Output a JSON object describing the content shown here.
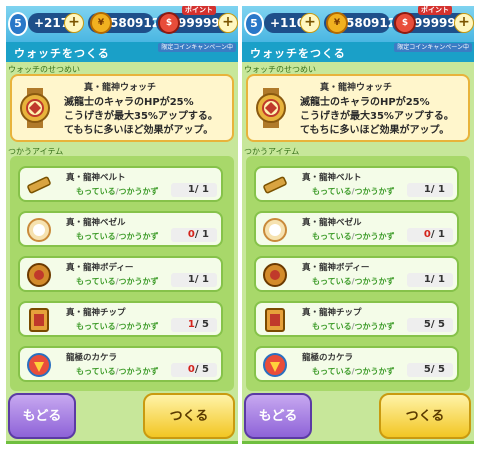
{
  "screens": [
    {
      "status": {
        "level": "5",
        "stat_value": "+217",
        "gold": "580912",
        "money": "9999999",
        "points_tag": "ポイント",
        "campaign_tag": "限定コインキャンペーン中"
      },
      "title": "ウォッチをつくる",
      "desc_label": "ウォッチのせつめい",
      "watch_name": "真・龍神ウォッチ",
      "desc_lines": [
        "滅龍士のキャラのHPが25%",
        "こうげきが最大35%アップする。",
        "てもちに多いほど効果がアップ。"
      ],
      "items_label": "つかうアイテム",
      "have_label": "もっている",
      "need_label": "つかうかず",
      "items": [
        {
          "name": "真・龍神ベルト",
          "have": "1",
          "need": "1",
          "short": false,
          "icon": "belt-icon"
        },
        {
          "name": "真・龍神ベゼル",
          "have": "0",
          "need": "1",
          "short": true,
          "icon": "bezel-icon"
        },
        {
          "name": "真・龍神ボディー",
          "have": "1",
          "need": "1",
          "short": false,
          "icon": "body-icon"
        },
        {
          "name": "真・龍神チップ",
          "have": "1",
          "need": "5",
          "short": true,
          "icon": "chip-icon"
        },
        {
          "name": "龍極のカケラ",
          "have": "0",
          "need": "5",
          "short": true,
          "icon": "shard-icon"
        }
      ],
      "back_label": "もどる",
      "make_label": "つくる"
    },
    {
      "status": {
        "level": "5",
        "stat_value": "+110",
        "gold": "580912",
        "money": "9999999",
        "points_tag": "ポイント",
        "campaign_tag": "限定コインキャンペーン中"
      },
      "title": "ウォッチをつくる",
      "desc_label": "ウォッチのせつめい",
      "watch_name": "真・龍神ウォッチ",
      "desc_lines": [
        "滅龍士のキャラのHPが25%",
        "こうげきが最大35%アップする。",
        "てもちに多いほど効果がアップ。"
      ],
      "items_label": "つかうアイテム",
      "have_label": "もっている",
      "need_label": "つかうかず",
      "items": [
        {
          "name": "真・龍神ベルト",
          "have": "1",
          "need": "1",
          "short": false,
          "icon": "belt-icon"
        },
        {
          "name": "真・龍神ベゼル",
          "have": "0",
          "need": "1",
          "short": true,
          "icon": "bezel-icon"
        },
        {
          "name": "真・龍神ボディー",
          "have": "1",
          "need": "1",
          "short": false,
          "icon": "body-icon"
        },
        {
          "name": "真・龍神チップ",
          "have": "5",
          "need": "5",
          "short": false,
          "icon": "chip-icon"
        },
        {
          "name": "龍極のカケラ",
          "have": "5",
          "need": "5",
          "short": false,
          "icon": "shard-icon"
        }
      ],
      "back_label": "もどる",
      "make_label": "つくる"
    }
  ],
  "colors": {
    "accent": "#1aa0c8",
    "short_count": "#d3231c",
    "have_text": "#3e9c2a"
  }
}
